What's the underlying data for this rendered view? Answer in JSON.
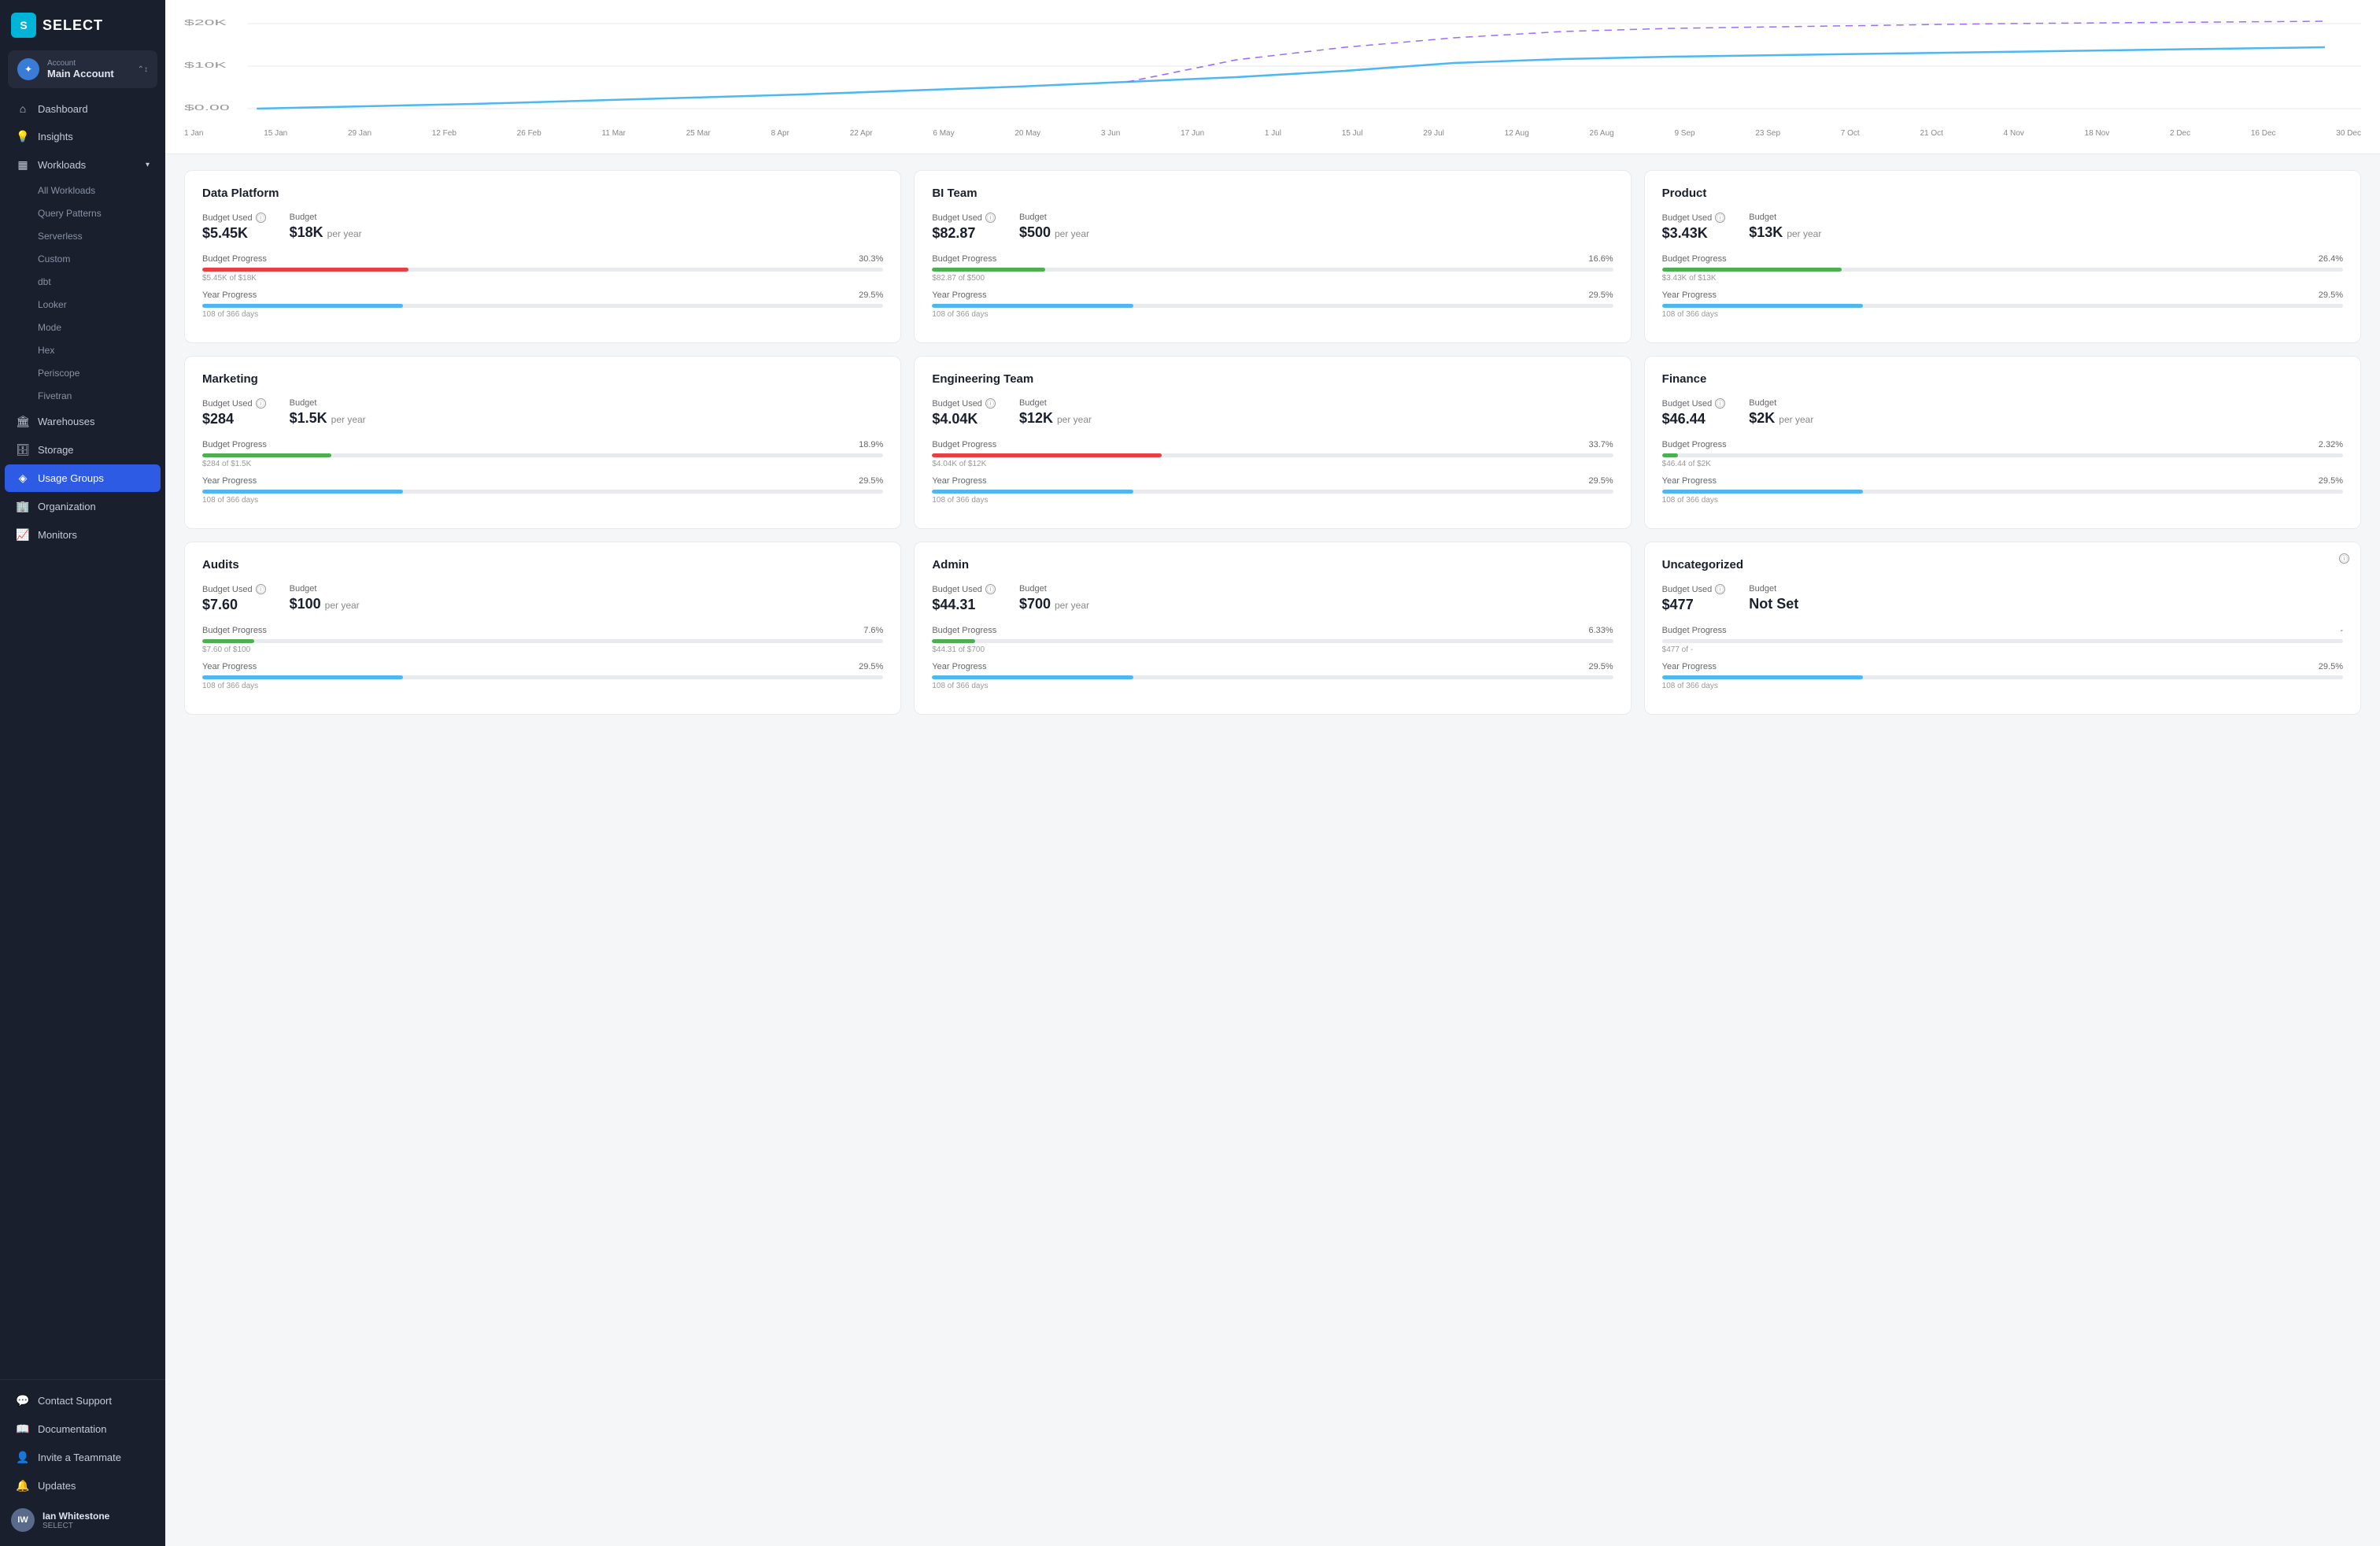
{
  "app": {
    "logo_icon": "S",
    "logo_text": "SELECT"
  },
  "account": {
    "label": "Account",
    "name": "Main Account"
  },
  "sidebar": {
    "nav_items": [
      {
        "id": "dashboard",
        "label": "Dashboard",
        "icon": "⌂",
        "active": false
      },
      {
        "id": "insights",
        "label": "Insights",
        "icon": "💡",
        "active": false
      },
      {
        "id": "workloads",
        "label": "Workloads",
        "icon": "▦",
        "active": false,
        "has_chevron": true
      }
    ],
    "workload_sub": [
      "All Workloads",
      "Query Patterns",
      "Serverless",
      "Custom",
      "dbt",
      "Looker",
      "Mode",
      "Hex",
      "Periscope",
      "Fivetran"
    ],
    "nav_items2": [
      {
        "id": "warehouses",
        "label": "Warehouses",
        "icon": "🏛"
      },
      {
        "id": "storage",
        "label": "Storage",
        "icon": "🗄"
      },
      {
        "id": "usage-groups",
        "label": "Usage Groups",
        "icon": "◈",
        "active": true
      },
      {
        "id": "organization",
        "label": "Organization",
        "icon": "🏢"
      },
      {
        "id": "monitors",
        "label": "Monitors",
        "icon": "📈"
      }
    ],
    "footer_items": [
      {
        "id": "contact-support",
        "label": "Contact Support",
        "icon": "💬"
      },
      {
        "id": "documentation",
        "label": "Documentation",
        "icon": "📖"
      },
      {
        "id": "invite-teammate",
        "label": "Invite a Teammate",
        "icon": "👤"
      },
      {
        "id": "updates",
        "label": "Updates",
        "icon": "🔔"
      }
    ],
    "user": {
      "name": "Ian Whitestone",
      "sub": "SELECT",
      "initials": "IW"
    }
  },
  "chart": {
    "y_labels": [
      "$20K",
      "$10K",
      "$0.00"
    ],
    "x_labels": [
      "1 Jan",
      "15 Jan",
      "29 Jan",
      "12 Feb",
      "26 Feb",
      "11 Mar",
      "25 Mar",
      "8 Apr",
      "22 Apr",
      "6 May",
      "20 May",
      "3 Jun",
      "17 Jun",
      "1 Jul",
      "15 Jul",
      "29 Jul",
      "12 Aug",
      "26 Aug",
      "9 Sep",
      "23 Sep",
      "7 Oct",
      "21 Oct",
      "4 Nov",
      "18 Nov",
      "2 Dec",
      "16 Dec",
      "30 Dec"
    ]
  },
  "cards": [
    {
      "id": "data-platform",
      "title": "Data Platform",
      "budget_used_label": "Budget Used",
      "budget_used": "$5.45K",
      "budget_label": "Budget",
      "budget": "$18K",
      "budget_period": "per year",
      "budget_progress_label": "Budget Progress",
      "budget_progress_pct": "30.3%",
      "budget_progress_fill": 30.3,
      "budget_progress_color": "#e84040",
      "budget_progress_sub": "$5.45K of $18K",
      "year_progress_label": "Year Progress",
      "year_progress_pct": "29.5%",
      "year_progress_fill": 29.5,
      "year_progress_color": "#4db8f0",
      "year_progress_sub": "108 of 366 days"
    },
    {
      "id": "bi-team",
      "title": "BI Team",
      "budget_used_label": "Budget Used",
      "budget_used": "$82.87",
      "budget_label": "Budget",
      "budget": "$500",
      "budget_period": "per year",
      "budget_progress_label": "Budget Progress",
      "budget_progress_pct": "16.6%",
      "budget_progress_fill": 16.6,
      "budget_progress_color": "#4caf50",
      "budget_progress_sub": "$82.87 of $500",
      "year_progress_label": "Year Progress",
      "year_progress_pct": "29.5%",
      "year_progress_fill": 29.5,
      "year_progress_color": "#4db8f0",
      "year_progress_sub": "108 of 366 days"
    },
    {
      "id": "product",
      "title": "Product",
      "budget_used_label": "Budget Used",
      "budget_used": "$3.43K",
      "budget_label": "Budget",
      "budget": "$13K",
      "budget_period": "per year",
      "budget_progress_label": "Budget Progress",
      "budget_progress_pct": "26.4%",
      "budget_progress_fill": 26.4,
      "budget_progress_color": "#4caf50",
      "budget_progress_sub": "$3.43K of $13K",
      "year_progress_label": "Year Progress",
      "year_progress_pct": "29.5%",
      "year_progress_fill": 29.5,
      "year_progress_color": "#4db8f0",
      "year_progress_sub": "108 of 366 days"
    },
    {
      "id": "marketing",
      "title": "Marketing",
      "budget_used_label": "Budget Used",
      "budget_used": "$284",
      "budget_label": "Budget",
      "budget": "$1.5K",
      "budget_period": "per year",
      "budget_progress_label": "Budget Progress",
      "budget_progress_pct": "18.9%",
      "budget_progress_fill": 18.9,
      "budget_progress_color": "#4caf50",
      "budget_progress_sub": "$284 of $1.5K",
      "year_progress_label": "Year Progress",
      "year_progress_pct": "29.5%",
      "year_progress_fill": 29.5,
      "year_progress_color": "#4db8f0",
      "year_progress_sub": "108 of 366 days"
    },
    {
      "id": "engineering-team",
      "title": "Engineering Team",
      "budget_used_label": "Budget Used",
      "budget_used": "$4.04K",
      "budget_label": "Budget",
      "budget": "$12K",
      "budget_period": "per year",
      "budget_progress_label": "Budget Progress",
      "budget_progress_pct": "33.7%",
      "budget_progress_fill": 33.7,
      "budget_progress_color": "#e84040",
      "budget_progress_sub": "$4.04K of $12K",
      "year_progress_label": "Year Progress",
      "year_progress_pct": "29.5%",
      "year_progress_fill": 29.5,
      "year_progress_color": "#4db8f0",
      "year_progress_sub": "108 of 366 days"
    },
    {
      "id": "finance",
      "title": "Finance",
      "budget_used_label": "Budget Used",
      "budget_used": "$46.44",
      "budget_label": "Budget",
      "budget": "$2K",
      "budget_period": "per year",
      "budget_progress_label": "Budget Progress",
      "budget_progress_pct": "2.32%",
      "budget_progress_fill": 2.32,
      "budget_progress_color": "#4caf50",
      "budget_progress_sub": "$46.44 of $2K",
      "year_progress_label": "Year Progress",
      "year_progress_pct": "29.5%",
      "year_progress_fill": 29.5,
      "year_progress_color": "#4db8f0",
      "year_progress_sub": "108 of 366 days"
    },
    {
      "id": "audits",
      "title": "Audits",
      "budget_used_label": "Budget Used",
      "budget_used": "$7.60",
      "budget_label": "Budget",
      "budget": "$100",
      "budget_period": "per year",
      "budget_progress_label": "Budget Progress",
      "budget_progress_pct": "7.6%",
      "budget_progress_fill": 7.6,
      "budget_progress_color": "#4caf50",
      "budget_progress_sub": "$7.60 of $100",
      "year_progress_label": "Year Progress",
      "year_progress_pct": "29.5%",
      "year_progress_fill": 29.5,
      "year_progress_color": "#4db8f0",
      "year_progress_sub": "108 of 366 days"
    },
    {
      "id": "admin",
      "title": "Admin",
      "budget_used_label": "Budget Used",
      "budget_used": "$44.31",
      "budget_label": "Budget",
      "budget": "$700",
      "budget_period": "per year",
      "budget_progress_label": "Budget Progress",
      "budget_progress_pct": "6.33%",
      "budget_progress_fill": 6.33,
      "budget_progress_color": "#4caf50",
      "budget_progress_sub": "$44.31 of $700",
      "year_progress_label": "Year Progress",
      "year_progress_pct": "29.5%",
      "year_progress_fill": 29.5,
      "year_progress_color": "#4db8f0",
      "year_progress_sub": "108 of 366 days"
    },
    {
      "id": "uncategorized",
      "title": "Uncategorized",
      "budget_used_label": "Budget Used",
      "budget_used": "$477",
      "budget_label": "Budget",
      "budget": "Not Set",
      "budget_period": "",
      "budget_progress_label": "Budget Progress",
      "budget_progress_pct": "-",
      "budget_progress_fill": 0,
      "budget_progress_color": "#4db8f0",
      "budget_progress_sub": "$477 of -",
      "year_progress_label": "Year Progress",
      "year_progress_pct": "29.5%",
      "year_progress_fill": 29.5,
      "year_progress_color": "#4db8f0",
      "year_progress_sub": "108 of 366 days",
      "has_info_icon": true
    }
  ]
}
